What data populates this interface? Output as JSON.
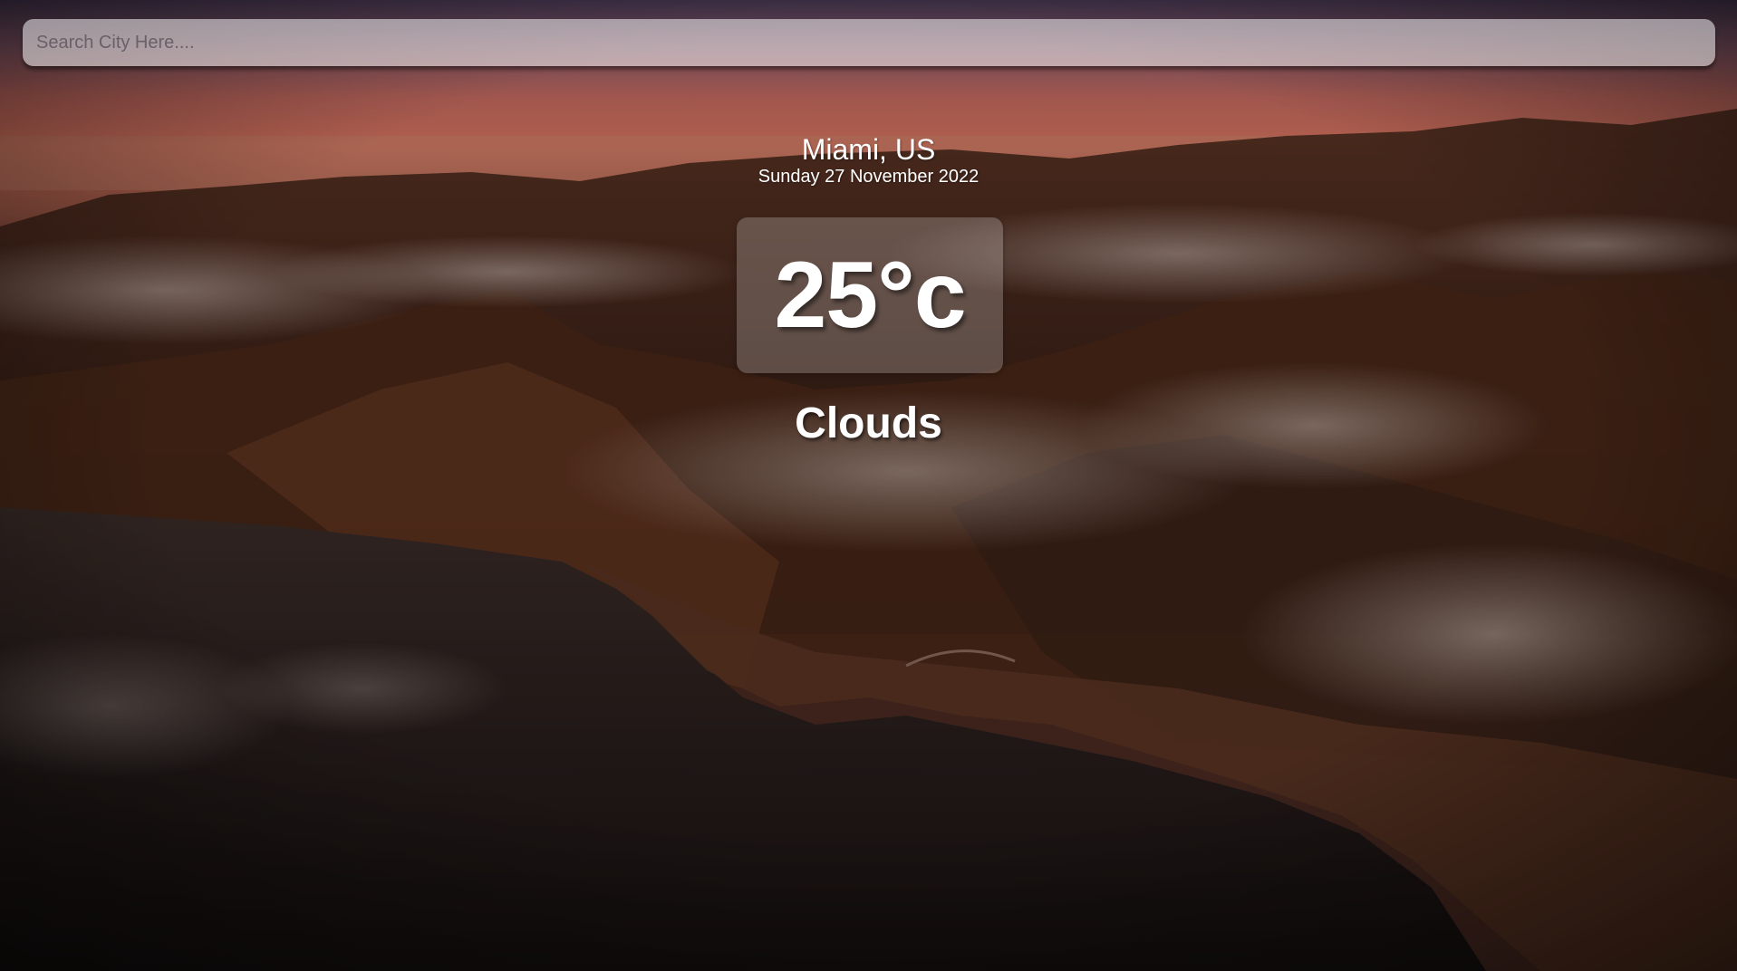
{
  "search": {
    "placeholder": "Search City Here...."
  },
  "weather": {
    "location": "Miami, US",
    "date": "Sunday 27 November 2022",
    "temperature": "25°c",
    "condition": "Clouds"
  },
  "background": {
    "description_icon": "coastal-mountains-sunset-background",
    "colors": {
      "sky_top": "#4a3a55",
      "sky_glow": "#d8745e",
      "mountain": "#5a3324",
      "sea": "#2a1f1d"
    }
  }
}
